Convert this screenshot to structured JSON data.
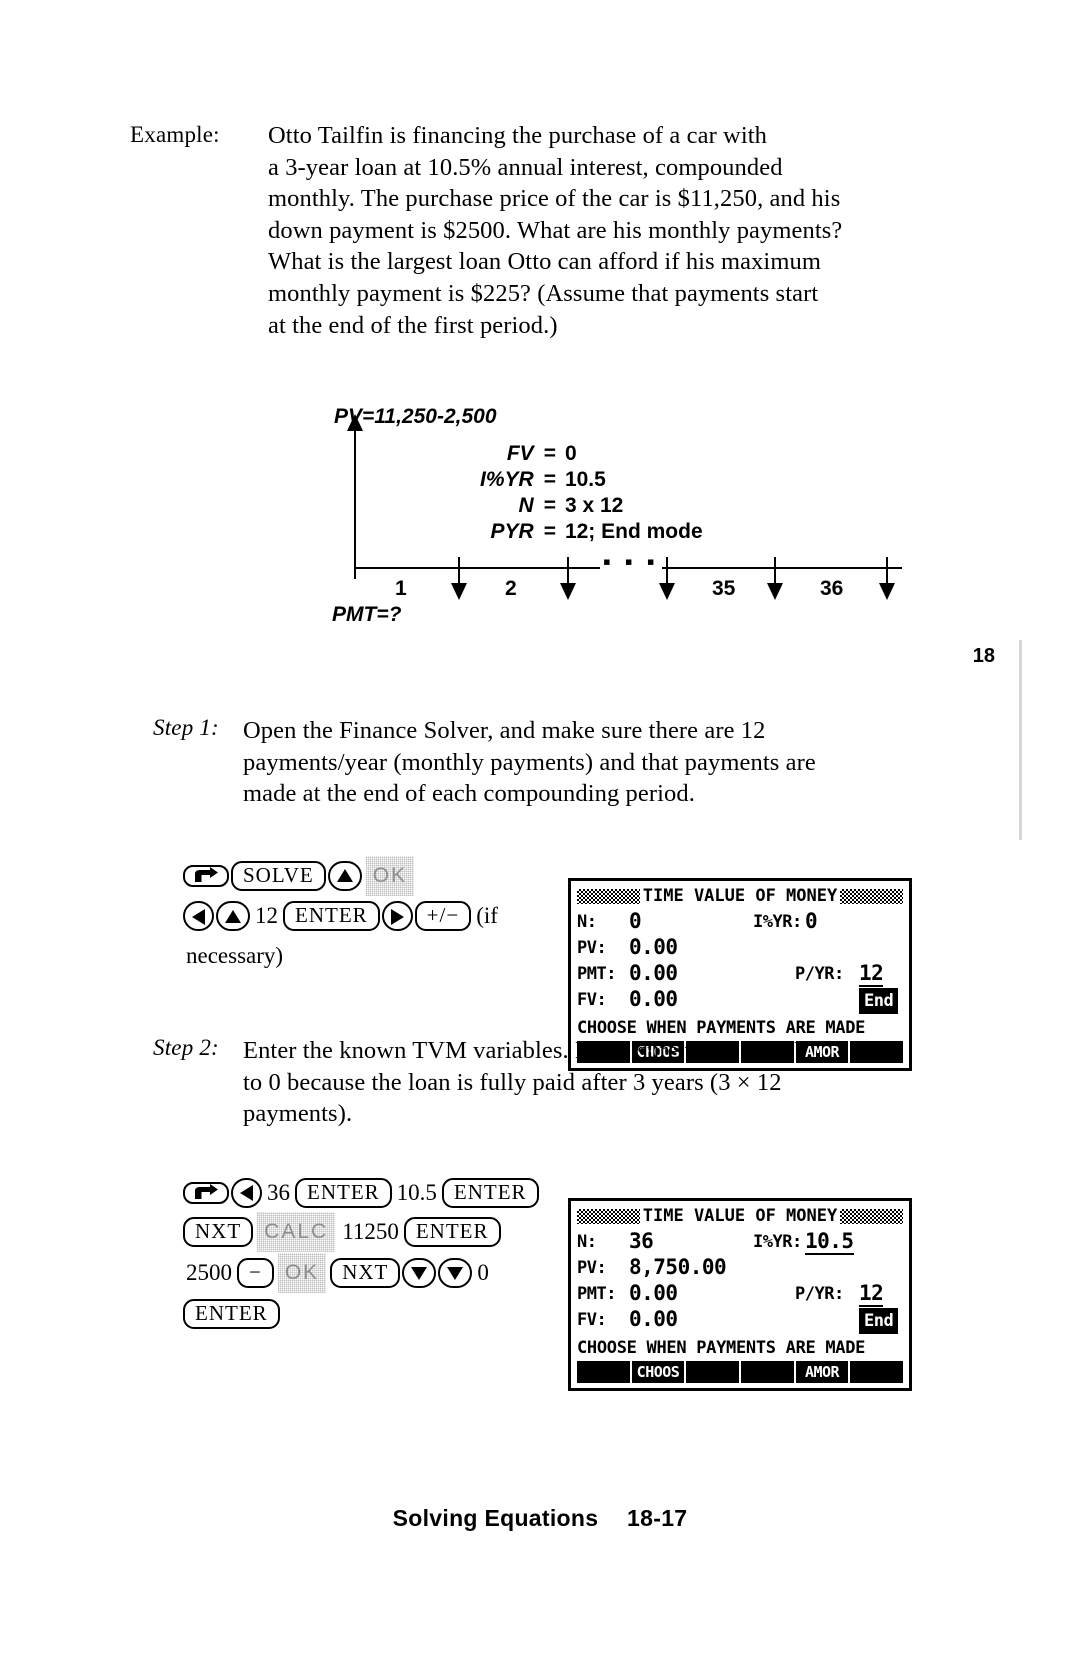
{
  "example": {
    "label": "Example:",
    "lines": [
      "Otto Tailfin is financing the purchase of a car with",
      "a 3-year loan at 10.5% annual interest, compounded",
      "monthly. The purchase price of the car is $11,250, and his",
      "down payment is $2500. What are his monthly payments?",
      "What is the largest loan Otto can afford if his maximum",
      "monthly payment is $225? (Assume that payments start",
      "at the end of the first period.)"
    ]
  },
  "diagram": {
    "pv_label": "PV=11,250-2,500",
    "pmt_label": "PMT=?",
    "ellipsis": "▪ ▪ ▪",
    "params": [
      {
        "name": "FV",
        "eq": "=",
        "value": "0"
      },
      {
        "name": "I%YR",
        "eq": "=",
        "value": "10.5"
      },
      {
        "name": "N",
        "eq": "=",
        "value": "3 x 12"
      },
      {
        "name": "PYR",
        "eq": "=",
        "value": "12; End  mode"
      }
    ],
    "periods": [
      "1",
      "2",
      "35",
      "36"
    ]
  },
  "margin": {
    "chapter_number": "18"
  },
  "step1": {
    "label": "Step 1:",
    "lines": [
      "Open the Finance Solver, and make sure there are 12",
      "payments/year (monthly payments) and that payments are",
      "made at the end of each compounding period."
    ],
    "keys": {
      "line1": [
        {
          "type": "key-shift",
          "label": "shift-arrow-icon"
        },
        {
          "type": "key",
          "label": "SOLVE"
        },
        {
          "type": "key-glyph",
          "label": "triangle-up-icon"
        },
        {
          "type": "softlabel",
          "label": "OK"
        }
      ],
      "line2": [
        {
          "type": "key-glyph",
          "label": "triangle-left-icon"
        },
        {
          "type": "key-glyph",
          "label": "triangle-up-icon"
        },
        {
          "type": "text",
          "label": "12"
        },
        {
          "type": "key",
          "label": "ENTER"
        },
        {
          "type": "key-glyph",
          "label": "triangle-right-icon"
        },
        {
          "type": "key",
          "label": "+/−"
        },
        {
          "type": "note",
          "label": "(if"
        }
      ],
      "line3": [
        {
          "type": "note",
          "label": "necessary)"
        }
      ]
    }
  },
  "step2": {
    "label": "Step 2:",
    "lines": [
      "Enter the known TVM variables. Make sure to set the FV",
      "to 0 because the loan is fully paid after 3 years (3 × 12",
      "payments)."
    ],
    "keys": {
      "line1": [
        {
          "type": "key-shift",
          "label": "shift-arrow-icon"
        },
        {
          "type": "key-glyph",
          "label": "triangle-left-icon"
        },
        {
          "type": "text",
          "label": "36"
        },
        {
          "type": "key",
          "label": "ENTER"
        },
        {
          "type": "text",
          "label": "10.5"
        },
        {
          "type": "key",
          "label": "ENTER"
        }
      ],
      "line2": [
        {
          "type": "key",
          "label": "NXT"
        },
        {
          "type": "softlabel",
          "label": "CALC"
        },
        {
          "type": "text",
          "label": "11250"
        },
        {
          "type": "key",
          "label": "ENTER"
        }
      ],
      "line3": [
        {
          "type": "text",
          "label": "2500"
        },
        {
          "type": "key",
          "label": "−"
        },
        {
          "type": "softlabel",
          "label": "OK"
        },
        {
          "type": "key",
          "label": "NXT"
        },
        {
          "type": "key-glyph",
          "label": "triangle-down-icon"
        },
        {
          "type": "key-glyph",
          "label": "triangle-down-icon"
        },
        {
          "type": "text",
          "label": "0"
        }
      ],
      "line4": [
        {
          "type": "key",
          "label": "ENTER"
        }
      ]
    }
  },
  "lcd1": {
    "title": "TIME VALUE OF MONEY",
    "rows": [
      {
        "name": "N:",
        "value": "0",
        "right_name": "I%YR:",
        "right_value": "0"
      },
      {
        "name": "PV:",
        "value": "0.00",
        "right_name": "",
        "right_value": ""
      },
      {
        "name": "PMT:",
        "value": "0.00",
        "right_name": "P/YR:",
        "right_value": "12",
        "right_underline": true
      },
      {
        "name": "FV:",
        "value": "0.00",
        "right_name": "",
        "right_value": "End",
        "right_inverted": true
      }
    ],
    "prompt": "CHOOSE WHEN PAYMENTS ARE MADE",
    "menu": [
      "",
      "CHOOS",
      "",
      "",
      "AMOR",
      ""
    ]
  },
  "lcd2": {
    "title": "TIME VALUE OF MONEY",
    "rows": [
      {
        "name": "N:",
        "value": "36",
        "right_name": "I%YR:",
        "right_value": "10.5",
        "right_underline": true
      },
      {
        "name": "PV:",
        "value": "8,750.00",
        "right_name": "",
        "right_value": ""
      },
      {
        "name": "PMT:",
        "value": "0.00",
        "right_name": "P/YR:",
        "right_value": "12",
        "right_underline": true
      },
      {
        "name": "FV:",
        "value": "0.00",
        "right_name": "",
        "right_value": "End",
        "right_inverted": true
      }
    ],
    "prompt": "CHOOSE WHEN PAYMENTS ARE MADE",
    "menu": [
      "",
      "CHOOS",
      "",
      "",
      "AMOR",
      ""
    ]
  },
  "footer": {
    "section": "Solving Equations",
    "page": "18-17"
  }
}
